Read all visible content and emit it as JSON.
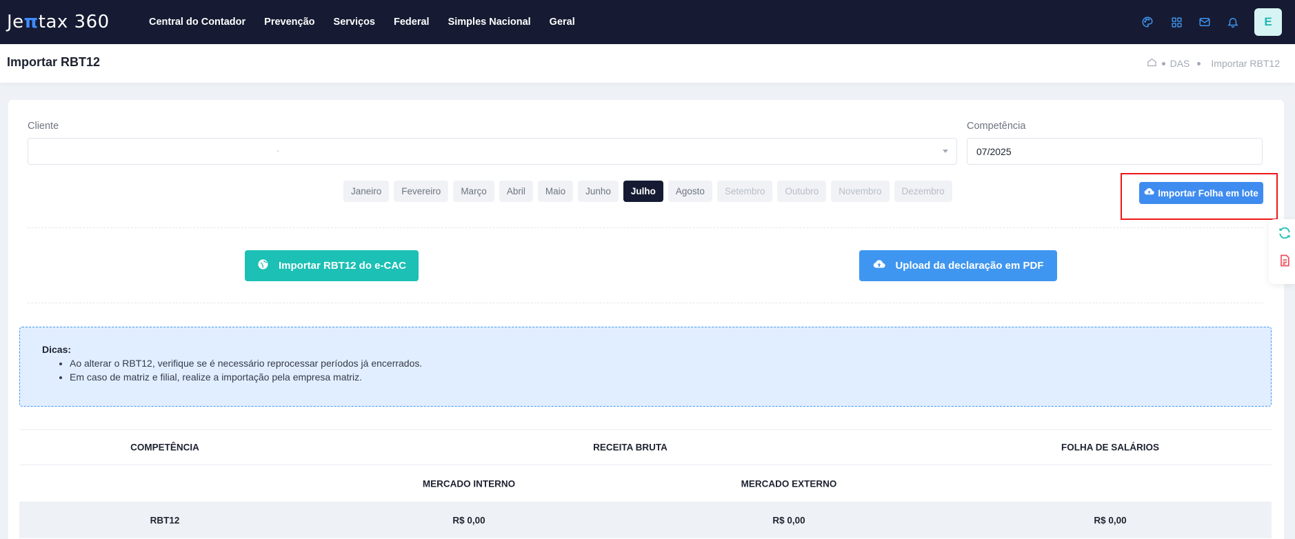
{
  "brand": {
    "logo_prefix": "Je",
    "logo_pi": "π",
    "logo_suffix": "tax 360"
  },
  "nav": {
    "items": [
      "Central do Contador",
      "Prevenção",
      "Serviços",
      "Federal",
      "Simples Nacional",
      "Geral"
    ]
  },
  "header_icons": [
    "palette-icon",
    "apps-grid-icon",
    "mail-icon",
    "bell-icon"
  ],
  "user": {
    "avatar_initial": "E"
  },
  "page": {
    "title": "Importar RBT12"
  },
  "breadcrumb": {
    "home_icon": "home-icon",
    "items": [
      "DAS",
      "Importar RBT12"
    ]
  },
  "form": {
    "cliente_label": "Cliente",
    "cliente_value": "·",
    "competencia_label": "Competência",
    "competencia_value": "07/2025"
  },
  "months": {
    "items": [
      "Janeiro",
      "Fevereiro",
      "Março",
      "Abril",
      "Maio",
      "Junho",
      "Julho",
      "Agosto",
      "Setembro",
      "Outubro",
      "Novembro",
      "Dezembro"
    ],
    "selected": "Julho",
    "disabled_from": "Setembro"
  },
  "buttons": {
    "importar_folha": "Importar Folha em lote",
    "importar_ecac": "Importar RBT12 do e-CAC",
    "upload_pdf": "Upload da declaração em PDF"
  },
  "tips": {
    "title": "Dicas:",
    "items": [
      "Ao alterar o RBT12, verifique se é necessário reprocessar períodos já encerrados.",
      "Em caso de matriz e filial, realize a importação pela empresa matriz."
    ]
  },
  "table": {
    "headers": [
      "COMPETÊNCIA",
      "RECEITA BRUTA",
      "FOLHA DE SALÁRIOS"
    ],
    "subheaders": [
      "MERCADO INTERNO",
      "MERCADO EXTERNO"
    ],
    "rows": [
      {
        "competencia": "RBT12",
        "mercado_interno": "R$ 0,00",
        "mercado_externo": "R$ 0,00",
        "folha": "R$ 0,00"
      }
    ]
  },
  "colors": {
    "topbar": "#161b33",
    "accent_blue": "#3f8cf0",
    "accent_teal": "#1cc0b5",
    "highlight_red": "#ef1616"
  }
}
